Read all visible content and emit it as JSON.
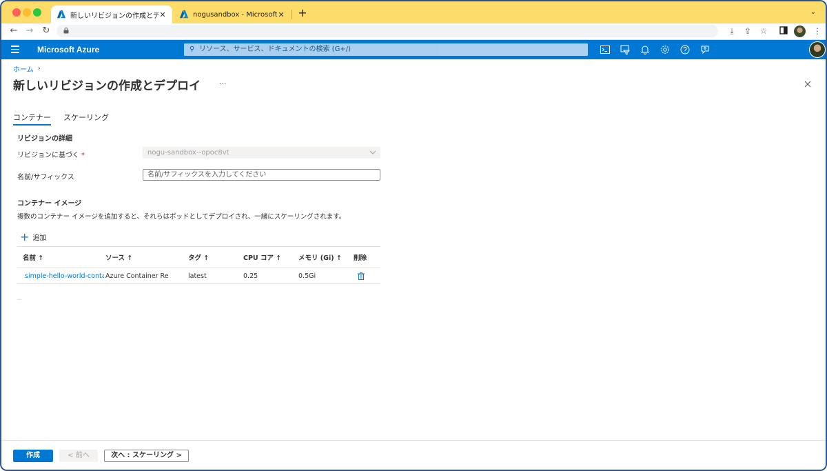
{
  "browser": {
    "tabs": [
      {
        "title": "新しいリビジョンの作成とデプロイ - Microsoft Azure",
        "favicon": "azure-logo",
        "active": true
      },
      {
        "title": "nogusandbox - Microsoft Azure",
        "favicon": "azure-logo",
        "active": false
      }
    ],
    "new_tab": "+"
  },
  "azure_bar": {
    "brand": "Microsoft Azure",
    "search_placeholder": "リソース、サービス、ドキュメントの検索 (G+/)",
    "icons": [
      "cloud-shell-icon",
      "directory-filter-icon",
      "notifications-icon",
      "settings-icon",
      "help-icon",
      "feedback-icon"
    ]
  },
  "breadcrumb": {
    "home": "ホーム"
  },
  "page": {
    "title": "新しいリビジョンの作成とデプロイ",
    "more": "···"
  },
  "tabs": [
    "コンテナー",
    "スケーリング"
  ],
  "revision_details": {
    "heading": "リビジョンの詳細",
    "based_on_label": "リビジョンに基づく",
    "required_mark": "*",
    "based_on_value": "nogu-sandbox--opoc8vt",
    "name_suffix_label": "名前/サフィックス",
    "name_suffix_placeholder": "名前/サフィックスを入力してください"
  },
  "container_image": {
    "heading": "コンテナー イメージ",
    "description": "複数のコンテナー イメージを追加すると、それらはポッドとしてデプロイされ、一緒にスケーリングされます。",
    "add_label": "追加",
    "columns": [
      "名前 ↑",
      "ソース ↑",
      "タグ ↑",
      "CPU コア ↑",
      "メモリ (Gi) ↑",
      "削除"
    ],
    "rows": [
      {
        "name": "simple-hello-world-contai",
        "source": "Azure Container Re...",
        "tag": "latest",
        "cpu": "0.25",
        "memory": "0.5Gi"
      }
    ],
    "trailing_dots": "..."
  },
  "footer": {
    "create": "作成",
    "previous": "< 前へ",
    "next": "次へ : スケーリング >"
  },
  "colors": {
    "azure_blue": "#0078d4",
    "tabstrip": "#fedc6a",
    "window_border": "#2a5595",
    "required": "#a4262c"
  }
}
